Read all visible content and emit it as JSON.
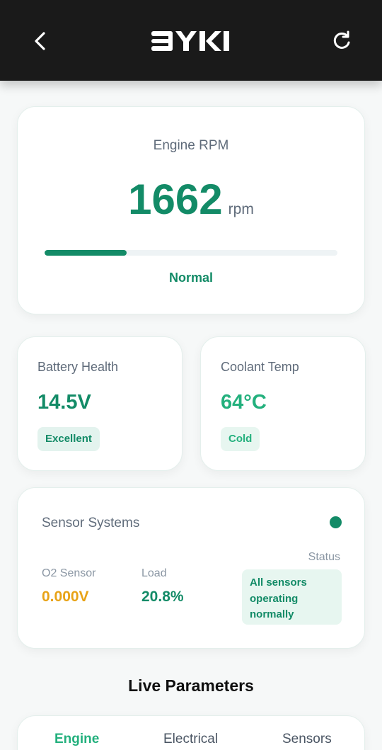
{
  "header": {
    "back_icon": "chevron-left-icon",
    "logo_text": "BYKI",
    "refresh_icon": "refresh-icon"
  },
  "rpm": {
    "title": "Engine RPM",
    "value": "1662",
    "unit": "rpm",
    "progress_fraction": 0.28,
    "status": "Normal"
  },
  "battery": {
    "title": "Battery Health",
    "value": "14.5V",
    "badge": "Excellent"
  },
  "coolant": {
    "title": "Coolant Temp",
    "value": "64°C",
    "badge": "Cold"
  },
  "sensors": {
    "title": "Sensor Systems",
    "status_label": "Status",
    "o2_label": "O2 Sensor",
    "o2_value": "0.000V",
    "load_label": "Load",
    "load_value": "20.8%",
    "status_text": "All sensors operating normally"
  },
  "live": {
    "title": "Live Parameters",
    "tabs": [
      "Engine",
      "Electrical",
      "Sensors"
    ],
    "active_tab": "Engine"
  },
  "colors": {
    "accent": "#138b67",
    "accent_light": "#23b07d",
    "warning": "#e8a317",
    "header_bg": "#1a1a1a",
    "page_bg": "#f6f8f8"
  }
}
